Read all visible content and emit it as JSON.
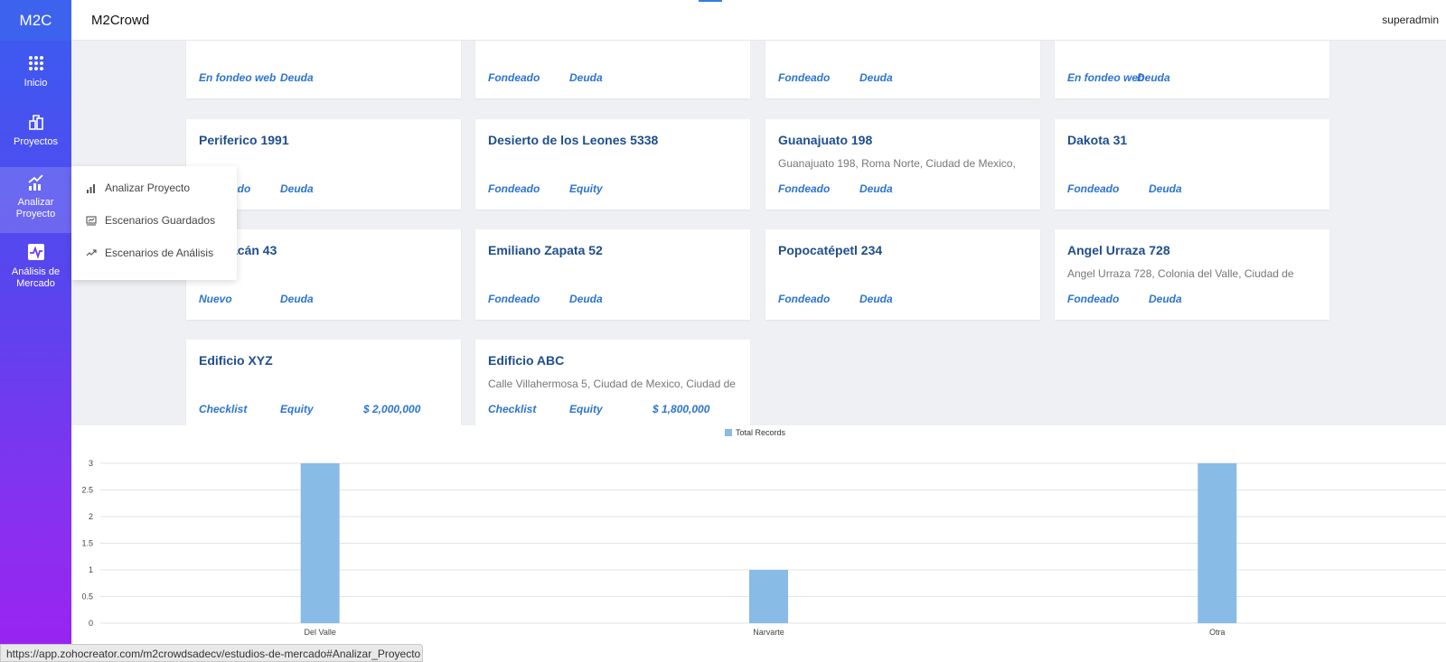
{
  "app": {
    "logo": "M2C",
    "brand": "M2Crowd",
    "user": "superadmin"
  },
  "sidebar": {
    "items": [
      {
        "label": "Inicio",
        "icon": "grid-icon"
      },
      {
        "label": "Proyectos",
        "icon": "buildings-icon"
      },
      {
        "label": "Analizar Proyecto",
        "icon": "chart-up-icon"
      },
      {
        "label": "Análisis de Mercado",
        "icon": "pulse-chart-icon"
      }
    ]
  },
  "dropdown": {
    "items": [
      {
        "label": "Analizar Proyecto",
        "icon": "bar-chart-icon"
      },
      {
        "label": "Escenarios Guardados",
        "icon": "saved-chart-icon"
      },
      {
        "label": "Escenarios de Análisis",
        "icon": "trend-icon"
      }
    ]
  },
  "cards": [
    {
      "title": "",
      "address": "",
      "status": "En fondeo web",
      "type": "Deuda",
      "amount": ""
    },
    {
      "title": "",
      "address": "",
      "status": "Fondeado",
      "type": "Deuda",
      "amount": ""
    },
    {
      "title": "",
      "address": "",
      "status": "Fondeado",
      "type": "Deuda",
      "amount": ""
    },
    {
      "title": "",
      "address": "",
      "status": "En fondeo web",
      "type": "Deuda",
      "amount": ""
    },
    {
      "title": "Periferico 1991",
      "address": "",
      "status": "Fondeado",
      "type": "Deuda",
      "amount": ""
    },
    {
      "title": "Desierto de los Leones 5338",
      "address": "",
      "status": "Fondeado",
      "type": "Equity",
      "amount": ""
    },
    {
      "title": "Guanajuato 198",
      "address": "Guanajuato 198, Roma Norte, Ciudad de Mexico,",
      "status": "Fondeado",
      "type": "Deuda",
      "amount": ""
    },
    {
      "title": "Dakota 31",
      "address": "",
      "status": "Fondeado",
      "type": "Deuda",
      "amount": ""
    },
    {
      "title": "Coyoacán 43",
      "address": "",
      "status": "Nuevo",
      "type": "Deuda",
      "amount": ""
    },
    {
      "title": "Emiliano Zapata 52",
      "address": "",
      "status": "Fondeado",
      "type": "Deuda",
      "amount": ""
    },
    {
      "title": "Popocatépetl 234",
      "address": "",
      "status": "Fondeado",
      "type": "Deuda",
      "amount": ""
    },
    {
      "title": "Angel Urraza 728",
      "address": "Angel Urraza 728, Colonia del Valle, Ciudad de",
      "status": "Fondeado",
      "type": "Deuda",
      "amount": ""
    },
    {
      "title": "Edificio XYZ",
      "address": "",
      "status": "Checklist",
      "type": "Equity",
      "amount": "$ 2,000,000"
    },
    {
      "title": "Edificio ABC",
      "address": "Calle Villahermosa 5, Ciudad de Mexico, Ciudad de",
      "status": "Checklist",
      "type": "Equity",
      "amount": "$ 1,800,000"
    }
  ],
  "chart_data": {
    "type": "bar",
    "categories": [
      "Del Valle",
      "Narvarte",
      "Otra"
    ],
    "series": [
      {
        "name": "Total Records",
        "values": [
          3,
          1,
          3
        ]
      }
    ],
    "ylim": [
      0,
      3
    ],
    "yticks": [
      "0",
      "0.5",
      "1",
      "1.5",
      "2",
      "2.5",
      "3"
    ],
    "legend": "top",
    "grid": true,
    "bar_color": "#88bbe6"
  },
  "statusbar": {
    "url": "https://app.zohocreator.com/m2crowdsadecv/estudios-de-mercado#Analizar_Proyecto"
  }
}
